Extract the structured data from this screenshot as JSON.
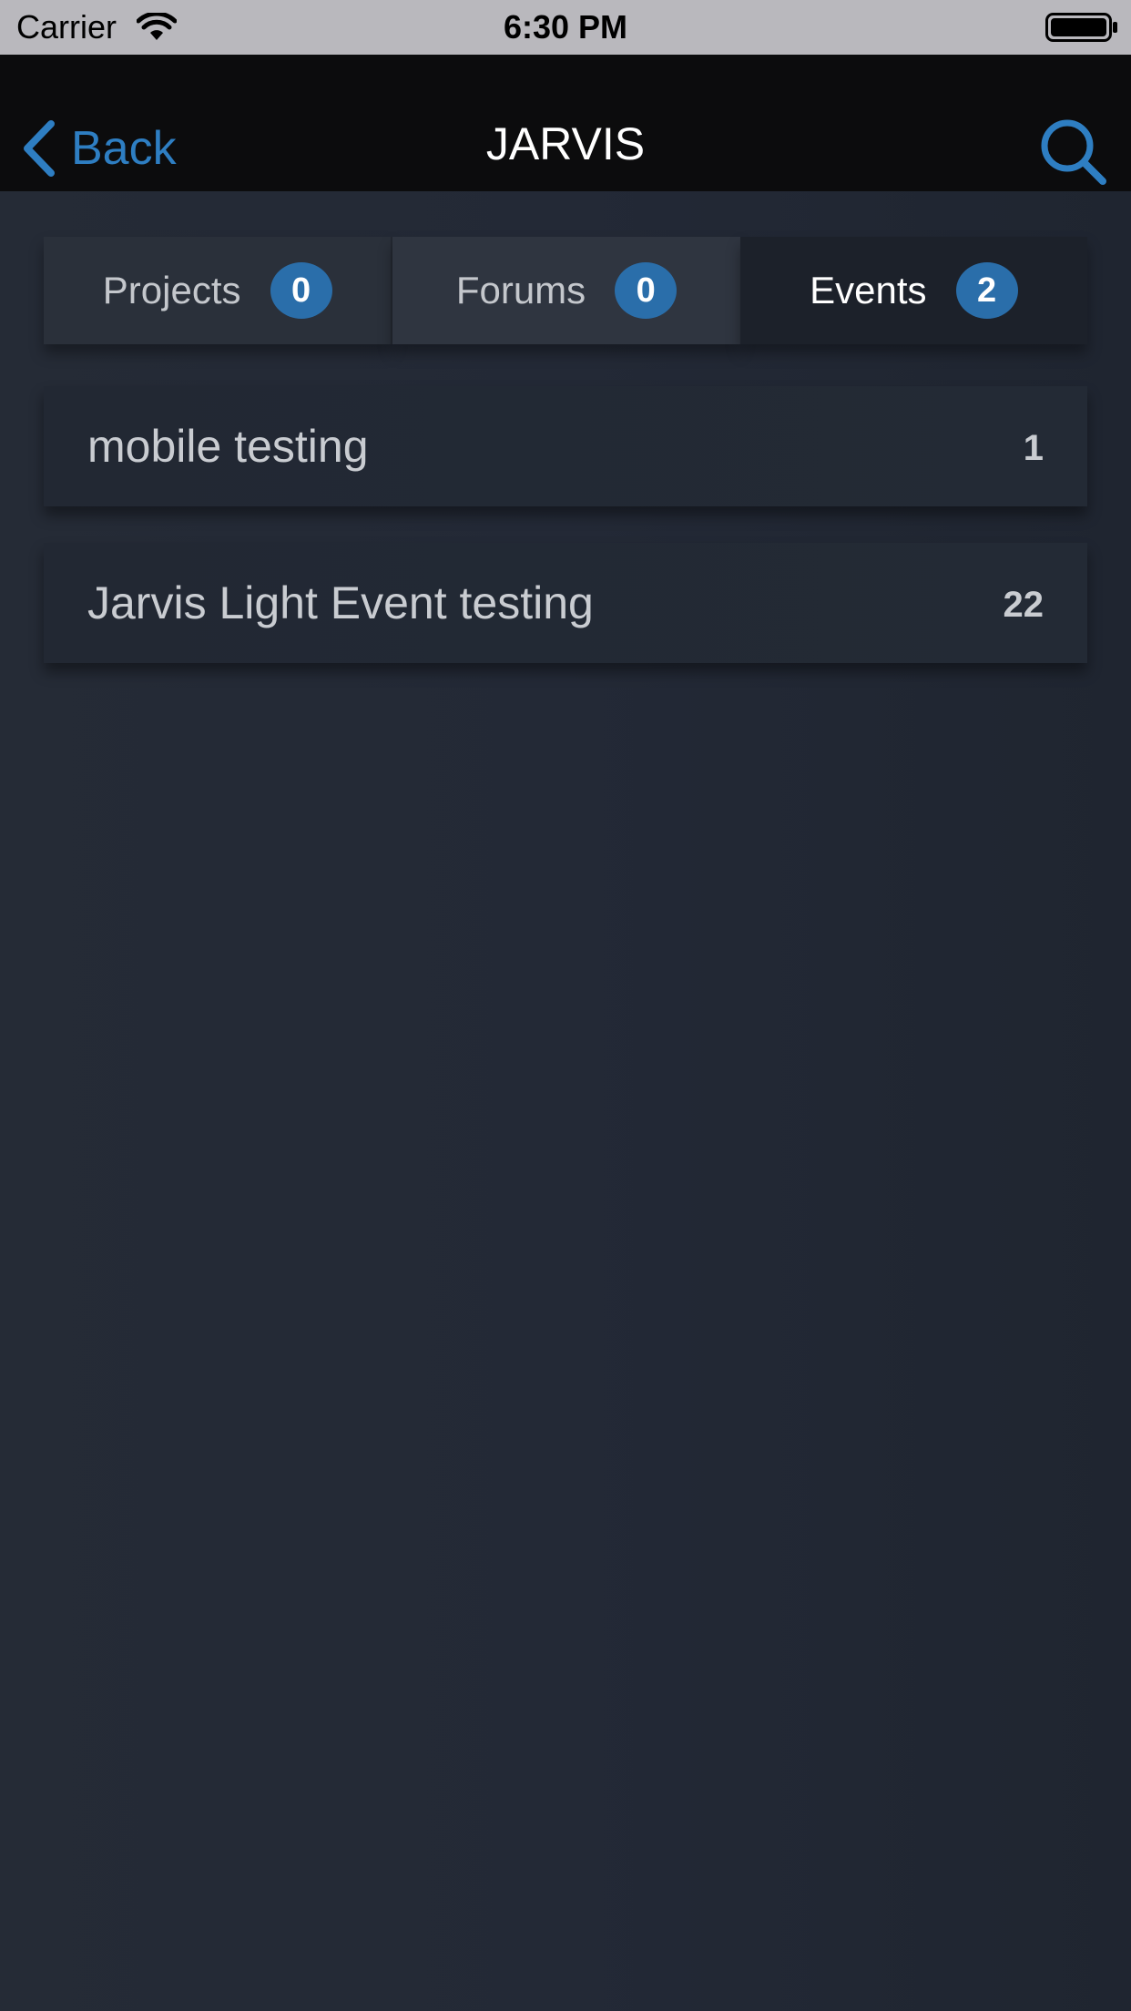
{
  "status_bar": {
    "carrier": "Carrier",
    "time": "6:30 PM",
    "icons": [
      "wifi-icon",
      "battery-icon"
    ]
  },
  "nav": {
    "back_label": "Back",
    "title": "JARVIS",
    "icons": [
      "chevron-left-icon",
      "search-icon"
    ],
    "accent_color": "#2e7ec2"
  },
  "tabs": [
    {
      "label": "Projects",
      "count": "0"
    },
    {
      "label": "Forums",
      "count": "0"
    },
    {
      "label": "Events",
      "count": "2"
    }
  ],
  "selected_tab": "Events",
  "events": [
    {
      "title": "mobile testing",
      "count": "1"
    },
    {
      "title": "Jarvis Light Event testing",
      "count": "22"
    }
  ],
  "colors": {
    "badge": "#2a6eaa",
    "nav_background": "#0c0c0d",
    "background": "#232936"
  }
}
